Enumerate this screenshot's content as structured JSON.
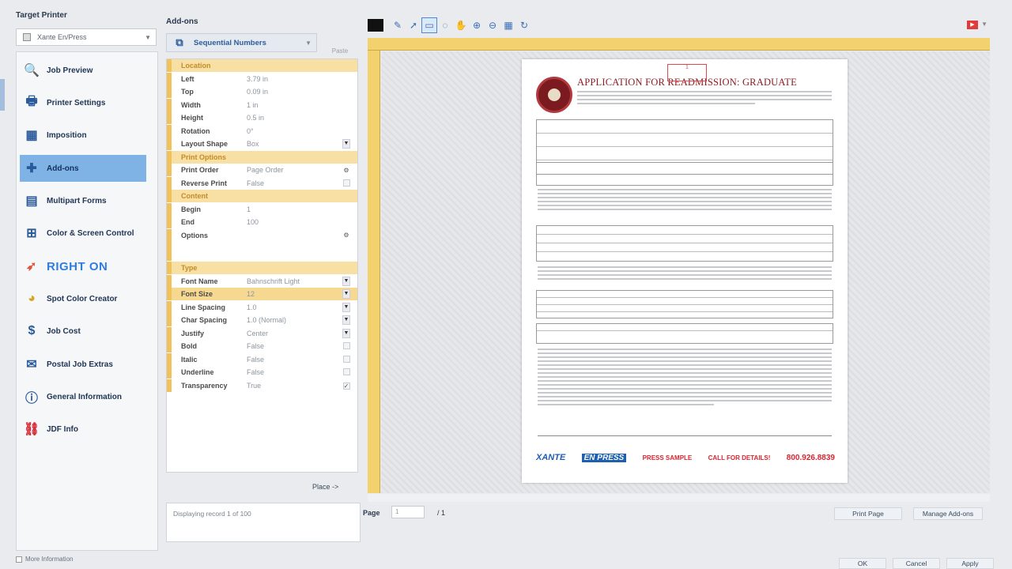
{
  "sidebar": {
    "target_label": "Target Printer",
    "printer_value": "Xante En/Press",
    "items": [
      {
        "label": "Job Preview",
        "icon": "magnifier-icon"
      },
      {
        "label": "Printer Settings",
        "icon": "printer-icon"
      },
      {
        "label": "Imposition",
        "icon": "grid-icon"
      },
      {
        "label": "Add-ons",
        "icon": "puzzle-icon"
      },
      {
        "label": "Multipart Forms",
        "icon": "forms-icon"
      },
      {
        "label": "Color & Screen Control",
        "icon": "color-grid-icon"
      },
      {
        "label": "RIGHT ON",
        "icon": "bird-icon"
      },
      {
        "label": "Spot Color Creator",
        "icon": "color-wheel-icon"
      },
      {
        "label": "Job Cost",
        "icon": "dollar-icon"
      },
      {
        "label": "Postal Job Extras",
        "icon": "postal-icon"
      },
      {
        "label": "General Information",
        "icon": "info-icon"
      },
      {
        "label": "JDF Info",
        "icon": "jdf-icon"
      }
    ],
    "more_info": "More Information"
  },
  "addons": {
    "title": "Add-ons",
    "selected_addon": "Sequential Numbers",
    "paste_label": "Paste",
    "place_label": "Place ->",
    "status_text": "Displaying record 1 of 100",
    "properties": [
      {
        "type": "section",
        "name": "Location"
      },
      {
        "name": "Left",
        "value": "3.79 in"
      },
      {
        "name": "Top",
        "value": "0.09 in"
      },
      {
        "name": "Width",
        "value": "1 in"
      },
      {
        "name": "Height",
        "value": "0.5 in"
      },
      {
        "name": "Rotation",
        "value": "0°"
      },
      {
        "name": "Layout Shape",
        "value": "Box",
        "control": "dropdown"
      },
      {
        "type": "section",
        "name": "Print Options"
      },
      {
        "name": "Print Order",
        "value": "Page Order",
        "control": "gear"
      },
      {
        "name": "Reverse Print",
        "value": "False",
        "control": "checkbox"
      },
      {
        "type": "section",
        "name": "Content"
      },
      {
        "name": "Begin",
        "value": "1"
      },
      {
        "name": "End",
        "value": "100"
      },
      {
        "name": "Options",
        "value": "",
        "control": "gear"
      },
      {
        "type": "section",
        "name": "Type"
      },
      {
        "name": "Font Name",
        "value": "Bahnschrift Light",
        "control": "dropdown"
      },
      {
        "name": "Font Size",
        "value": "12",
        "control": "dropdown",
        "selected": true
      },
      {
        "name": "Line Spacing",
        "value": "1.0",
        "control": "dropdown"
      },
      {
        "name": "Char Spacing",
        "value": "1.0 (Normal)",
        "control": "dropdown"
      },
      {
        "name": "Justify",
        "value": "Center",
        "control": "dropdown"
      },
      {
        "name": "Bold",
        "value": "False",
        "control": "checkbox"
      },
      {
        "name": "Italic",
        "value": "False",
        "control": "checkbox"
      },
      {
        "name": "Underline",
        "value": "False",
        "control": "checkbox"
      },
      {
        "name": "Transparency",
        "value": "True",
        "control": "checkbox",
        "checked": true
      }
    ]
  },
  "preview": {
    "page_label": "Page",
    "page_value": "1",
    "page_total": "/ 1",
    "print_page": "Print Page",
    "manage_addons": "Manage Add-ons",
    "ok": "OK",
    "cancel": "Cancel",
    "apply": "Apply",
    "doc": {
      "title": "APPLICATION FOR READMISSION: GRADUATE",
      "number_box": "1",
      "footer_xante": "XANTE",
      "footer_express": "EN PRESS",
      "footer_sample": "PRESS SAMPLE",
      "footer_call": "CALL FOR DETAILS!",
      "footer_phone": "800.926.8839"
    }
  },
  "colors": {
    "accent": "#7fb3e6",
    "ruler": "#f3d26d",
    "section": "#f8dfa3",
    "brand_red": "#d62631"
  }
}
